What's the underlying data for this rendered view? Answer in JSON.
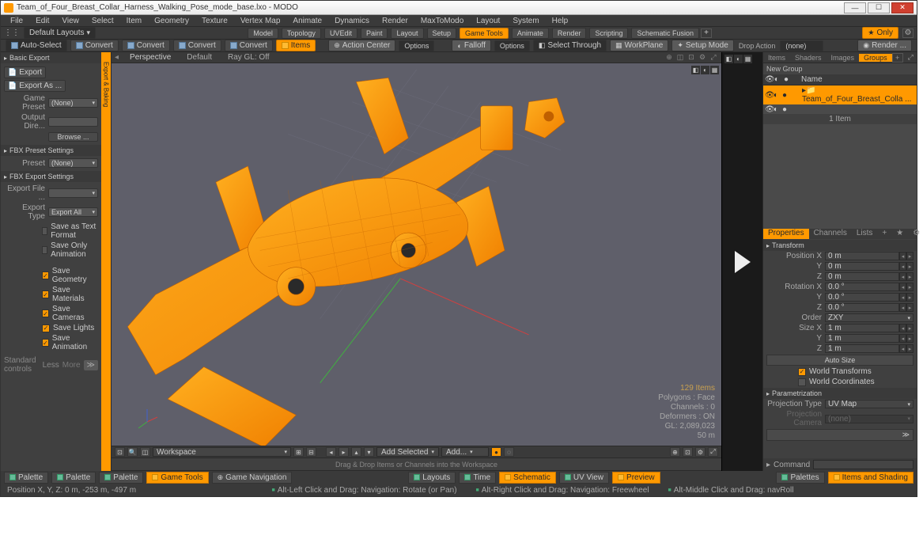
{
  "title": "Team_of_Four_Breast_Collar_Harness_Walking_Pose_mode_base.lxo - MODO",
  "menu": [
    "File",
    "Edit",
    "View",
    "Select",
    "Item",
    "Geometry",
    "Texture",
    "Vertex Map",
    "Animate",
    "Dynamics",
    "Render",
    "MaxToModo",
    "Layout",
    "System",
    "Help"
  ],
  "layouts_label": "Default Layouts",
  "row2_tabs": [
    "Model",
    "Topology",
    "UVEdit",
    "Paint",
    "Layout",
    "Setup",
    "Game Tools",
    "Animate",
    "Render",
    "Scripting",
    "Schematic Fusion"
  ],
  "row2_active": "Game Tools",
  "only_label": "Only",
  "toolrow": {
    "autoselect": "Auto-Select",
    "convert": "Convert",
    "items": "Items",
    "actioncenter": "Action Center",
    "options": "Options",
    "falloff": "Falloff",
    "selectthrough": "Select Through",
    "workplane": "WorkPlane",
    "setupmode": "Setup Mode",
    "dropaction": "Drop Action",
    "none": "(none)",
    "render": "Render ..."
  },
  "left": {
    "hdr": "Basic Export",
    "export": "Export",
    "exportas": "Export As ...",
    "gamepreset": "Game Preset",
    "none": "(None)",
    "outputdir": "Output Dire...",
    "browse": "Browse ...",
    "fbxpreset": "FBX Preset Settings",
    "preset": "Preset",
    "fbxsettings": "FBX Export Settings",
    "exportfile": "Export File ...",
    "exporttype": "Export Type",
    "exportall": "Export All",
    "savetext": "Save as Text Format",
    "saveonlyanim": "Save Only Animation",
    "savegeo": "Save Geometry",
    "savemat": "Save Materials",
    "savecam": "Save Cameras",
    "savelight": "Save Lights",
    "saveanim": "Save Animation",
    "stdctrl": "Standard controls",
    "less": "Less",
    "more": "More",
    "sidetab": "Export & Baking"
  },
  "vp": {
    "tabs": [
      "Perspective",
      "Default",
      "Ray GL: Off"
    ],
    "info1": "129 Items",
    "info2": "Polygons : Face",
    "info3": "Channels : 0",
    "info4": "Deformers : ON",
    "info5": "GL: 2,089,023",
    "info6": "50 m"
  },
  "right": {
    "tabs": [
      "Items",
      "Shaders",
      "Images",
      "Groups"
    ],
    "active": "Groups",
    "newgroup": "New Group",
    "namecol": "Name",
    "item": "Team_of_Four_Breast_Colla ...",
    "count": "1 Item",
    "proptabs": [
      "Properties",
      "Channels",
      "Lists"
    ],
    "propactive": "Properties",
    "transform": "Transform",
    "posX": "Position X",
    "posY": "Y",
    "posZ": "Z",
    "rotX": "Rotation X",
    "rotY": "Y",
    "rotZ": "Z",
    "order": "Order",
    "zxy": "ZXY",
    "sizeX": "Size X",
    "sizeY": "Y",
    "sizeZ": "Z",
    "v0m": "0 m",
    "v0d": "0.0 °",
    "v1m": "1 m",
    "autosize": "Auto Size",
    "worldt": "World Transforms",
    "worldc": "World Coordinates",
    "param": "Parametrization",
    "projtype": "Projection Type",
    "uvmap": "UV Map",
    "projcam": "Projection Camera",
    "projcamv": "(none)",
    "command": "Command"
  },
  "ws": {
    "name": "Workspace",
    "addsel": "Add Selected",
    "add": "Add...",
    "drag": "Drag & Drop Items or Channels into the Workspace"
  },
  "bottom": {
    "palette": "Palette",
    "gametools": "Game Tools",
    "gamenav": "Game Navigation",
    "layouts": "Layouts",
    "time": "Time",
    "schematic": "Schematic",
    "uvview": "UV View",
    "preview": "Preview",
    "palettes": "Palettes",
    "itemshading": "Items and Shading"
  },
  "status": {
    "pos": "Position X, Y, Z:   0 m, -253 m, -497 m",
    "h1": "Alt-Left Click and Drag: Navigation: Rotate (or Pan)",
    "h2": "Alt-Right Click and Drag: Navigation: Freewheel",
    "h3": "Alt-Middle Click and Drag: navRoll"
  }
}
